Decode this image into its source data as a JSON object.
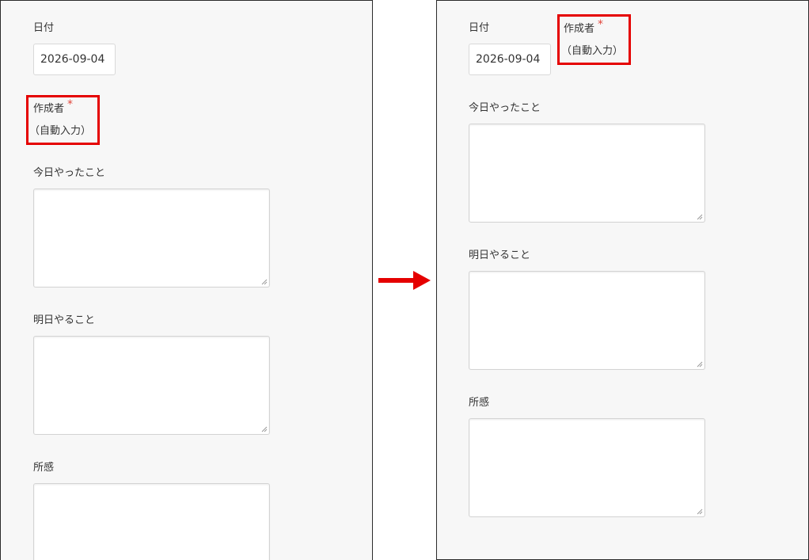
{
  "colors": {
    "highlight": "#e50000",
    "required_mark": "#e0463c",
    "panel_bg": "#f7f7f7",
    "arrow": "#e50000"
  },
  "before": {
    "date": {
      "label": "日付",
      "value": "2026-09-04"
    },
    "author": {
      "label": "作成者",
      "required_mark": "*",
      "auto_text": "（自動入力）"
    },
    "today": {
      "label": "今日やったこと",
      "value": ""
    },
    "tomorrow": {
      "label": "明日やること",
      "value": ""
    },
    "impression": {
      "label": "所感",
      "value": ""
    }
  },
  "after": {
    "date": {
      "label": "日付",
      "value": "2026-09-04"
    },
    "author": {
      "label": "作成者",
      "required_mark": "*",
      "auto_text": "（自動入力）"
    },
    "today": {
      "label": "今日やったこと",
      "value": ""
    },
    "tomorrow": {
      "label": "明日やること",
      "value": ""
    },
    "impression": {
      "label": "所感",
      "value": ""
    }
  },
  "transition_icon": "right-arrow-icon"
}
